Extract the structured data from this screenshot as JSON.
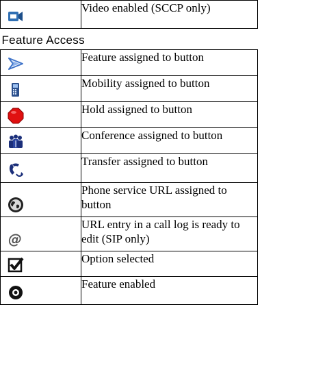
{
  "rows_top": [
    {
      "icon": "video-camera-icon",
      "description": "Video enabled (SCCP only)"
    }
  ],
  "section": {
    "title": "Feature Access"
  },
  "rows": [
    {
      "icon": "feature-arrow-icon",
      "description": "Feature assigned to button"
    },
    {
      "icon": "mobility-phone-icon",
      "description": "Mobility assigned to button"
    },
    {
      "icon": "hold-icon",
      "description": "Hold assigned to button"
    },
    {
      "icon": "conference-icon",
      "description": "Conference assigned to button"
    },
    {
      "icon": "transfer-icon",
      "description": "Transfer assigned to button"
    },
    {
      "icon": "globe-icon",
      "description": "Phone service URL assigned to button"
    },
    {
      "icon": "at-sign-icon",
      "description": "URL entry in a call log is ready to edit (SIP only)"
    },
    {
      "icon": "checkbox-checked-icon",
      "description": "Option selected"
    },
    {
      "icon": "feature-enabled-icon",
      "description": "Feature enabled"
    }
  ],
  "colors": {
    "video_icon": "#2f6fb3",
    "feature_arrow": "#3f74c9",
    "hold_red": "#e01010",
    "conference_blue": "#1b2f7a",
    "globe_dark": "#222222"
  }
}
